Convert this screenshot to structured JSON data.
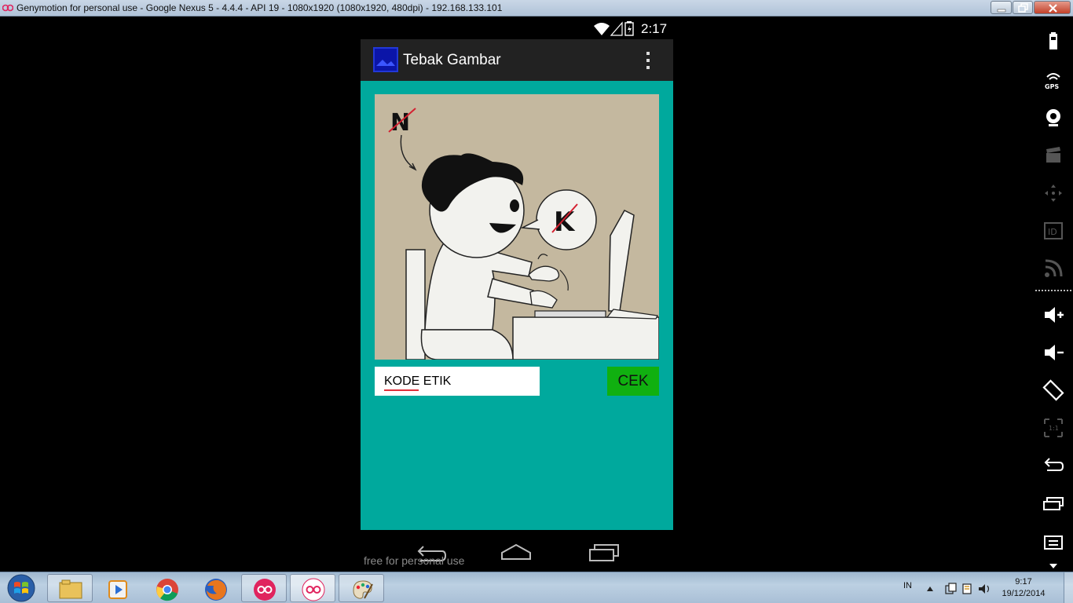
{
  "window": {
    "title": "Genymotion for personal use - Google Nexus 5 - 4.4.4 - API 19 - 1080x1920 (1080x1920, 480dpi) - 192.168.133.101"
  },
  "status_bar": {
    "time": "2:17"
  },
  "action_bar": {
    "title": "Tebak Gambar"
  },
  "quiz": {
    "answer_value": "KODE ETIK",
    "check_label": "CEK"
  },
  "watermark": "free for personal use",
  "taskbar": {
    "language": "IN",
    "time": "9:17",
    "date": "19/12/2014"
  },
  "colors": {
    "content_bg": "#00a99d",
    "check_button": "#10b010",
    "action_bar": "#222222"
  }
}
